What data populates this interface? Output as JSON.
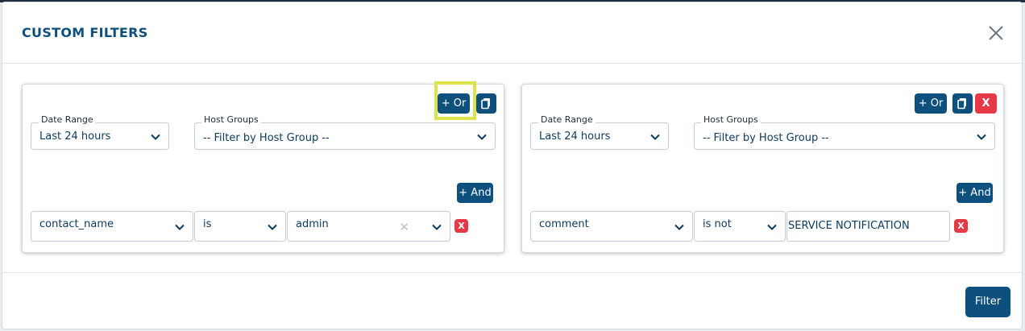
{
  "modal": {
    "title": "CUSTOM FILTERS",
    "close_icon": "close-icon"
  },
  "cards": [
    {
      "or_label": "+ Or",
      "copy_icon": "copy-icon",
      "date_range": {
        "label": "Date Range",
        "value": "Last 24 hours"
      },
      "host_groups": {
        "label": "Host Groups",
        "value": "-- Filter by Host Group --"
      },
      "and_label": "+ And",
      "condition": {
        "field": "contact_name",
        "operator": "is",
        "value": "admin",
        "clear": "✕"
      },
      "remove_label": "X"
    },
    {
      "or_label": "+ Or",
      "copy_icon": "copy-icon",
      "delete_label": "X",
      "date_range": {
        "label": "Date Range",
        "value": "Last 24 hours"
      },
      "host_groups": {
        "label": "Host Groups",
        "value": "-- Filter by Host Group --"
      },
      "and_label": "+ And",
      "condition": {
        "field": "comment",
        "operator": "is not",
        "value": "SERVICE NOTIFICATION"
      },
      "remove_label": "X"
    }
  ],
  "footer": {
    "filter_label": "Filter"
  },
  "colors": {
    "primary": "#0d4f7d",
    "danger": "#e63946",
    "highlight": "#dde34a"
  }
}
